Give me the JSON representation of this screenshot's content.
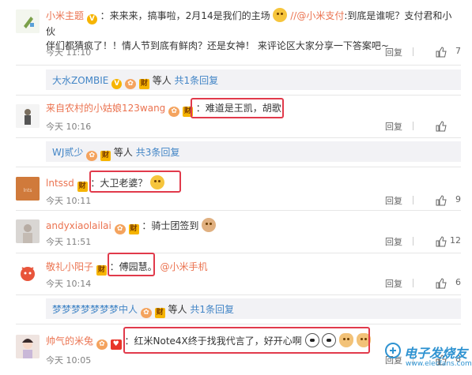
{
  "colors": {
    "accent_link": "#eb7350",
    "sub_link": "#4285c6",
    "highlight_box": "#e13a4b",
    "group_bg": "#f2f2f5"
  },
  "comments": [
    {
      "user": "小米主题",
      "text_1": "：来来来，搞事啦，2月14是我们的主场",
      "mention": "//@小米支付",
      "text_2": ":到底是谁呢？支付君和小伙",
      "text_3": "伴们都猜疯了！！情人节到底有鲜肉？还是女神！ 来评论区大家分享一下答案吧~",
      "time": "今天 11:10",
      "reply": "回复",
      "likes": "7"
    },
    {
      "group_summary": {
        "user": "大水ZOMBIE",
        "suffix": "等人",
        "link": "共1条回复"
      }
    },
    {
      "user": "来自农村的小姑娘123wang",
      "text": "：难道是王凯，胡歌",
      "time": "今天 10:16",
      "reply": "回复",
      "likes": ""
    },
    {
      "group_summary": {
        "user": "WJ贰少",
        "suffix": "等人",
        "link": "共3条回复"
      }
    },
    {
      "user": "lntssd",
      "text": "：大卫老婆？",
      "time": "今天 10:11",
      "reply": "回复",
      "likes": "9"
    },
    {
      "user": "andyxiaolailai",
      "text": "：骑士团签到",
      "time": "今天 11:51",
      "reply": "回复",
      "likes": "12"
    },
    {
      "user": "敬礼小阳子",
      "text": "：傅园慧。",
      "mention": "@小米手机",
      "time": "今天 10:14",
      "reply": "回复",
      "likes": "6"
    },
    {
      "group_summary": {
        "user": "梦梦梦梦梦梦梦中人",
        "suffix": "等人",
        "link": "共1条回复"
      }
    },
    {
      "user": "帅气的米兔",
      "text": "：红米Note4X终于找我代言了，好开心啊",
      "time": "今天 10:05",
      "reply": "回复",
      "likes": "8"
    }
  ],
  "watermark": {
    "text": "电子发烧友",
    "url": "www.elecfans.com"
  }
}
